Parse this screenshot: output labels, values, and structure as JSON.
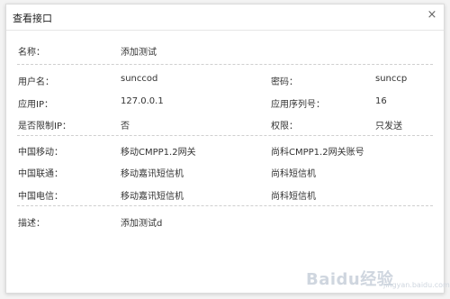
{
  "dialog": {
    "title": "查看接口",
    "close_glyph": "×"
  },
  "basic": {
    "name_label": "名称：",
    "name_value": "添加测试"
  },
  "account": {
    "rows": [
      {
        "l1": "用户名：",
        "v1": "sunccod",
        "l2": "密码：",
        "v2": "sunccp"
      },
      {
        "l1": "应用IP：",
        "v1": "127.0.0.1",
        "l2": "应用序列号：",
        "v2": "16"
      },
      {
        "l1": "是否限制IP：",
        "v1": "否",
        "l2": "权限：",
        "v2": "只发送"
      }
    ]
  },
  "carriers": {
    "rows": [
      {
        "carrier": "中国移动：",
        "gateway": "移动CMPP1.2网关",
        "account": "尚科CMPP1.2网关账号"
      },
      {
        "carrier": "中国联通：",
        "gateway": "移动嘉讯短信机",
        "account": "尚科短信机"
      },
      {
        "carrier": "中国电信：",
        "gateway": "移动嘉讯短信机",
        "account": "尚科短信机"
      }
    ]
  },
  "description": {
    "label": "描述：",
    "value": "添加测试d"
  },
  "watermark": {
    "logo": "Baidu经验",
    "url": "jingyan.baidu.com"
  }
}
